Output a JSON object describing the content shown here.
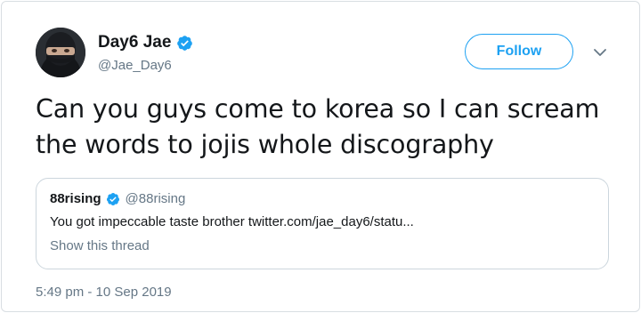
{
  "author": {
    "display_name": "Day6 Jae",
    "handle": "@Jae_Day6",
    "avatar_icon": "avatar-masked-person",
    "verified_icon": "verified-badge-icon"
  },
  "actions": {
    "follow_label": "Follow",
    "menu_icon": "chevron-down-icon"
  },
  "tweet": {
    "line1": "Can you guys come to korea so I can scream",
    "line2": "the words to jojis whole discography"
  },
  "quoted_tweet": {
    "display_name": "88rising",
    "handle": "@88rising",
    "text": "You got impeccable taste brother twitter.com/jae_day6/statu...",
    "show_thread_label": "Show this thread"
  },
  "timestamp": "5:49 pm - 10 Sep 2019",
  "colors": {
    "accent": "#1da1f2",
    "text": "#14171a",
    "secondary_text": "#657786",
    "border": "#ccd6dd"
  }
}
